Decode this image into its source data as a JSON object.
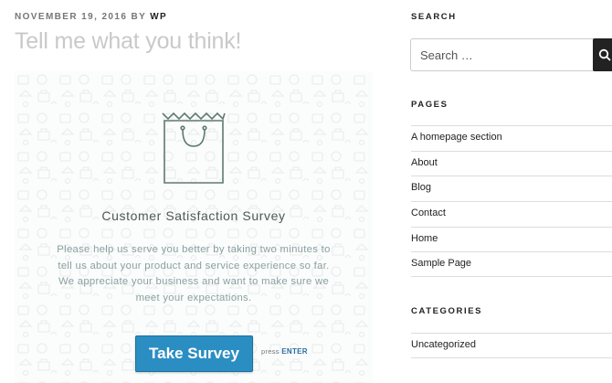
{
  "post": {
    "date": "November 19, 2016",
    "by": "by",
    "author": "wp",
    "title": "Tell me what you think!"
  },
  "survey": {
    "icon": "shopping-bag-icon",
    "title": "Customer Satisfaction Survey",
    "description": "Please help us serve you better by taking two minutes to tell us about your product and service experience so far. We appreciate your business and want to make sure we meet your expectations.",
    "button_label": "Take Survey",
    "press_label": "press",
    "press_key": "ENTER",
    "accent_color": "#2b8ec3"
  },
  "sidebar": {
    "search": {
      "title": "Search",
      "placeholder": "Search …",
      "button_icon": "search-icon"
    },
    "pages": {
      "title": "Pages",
      "items": [
        "A homepage section",
        "About",
        "Blog",
        "Contact",
        "Home",
        "Sample Page"
      ]
    },
    "categories": {
      "title": "Categories",
      "items": [
        "Uncategorized"
      ]
    }
  }
}
